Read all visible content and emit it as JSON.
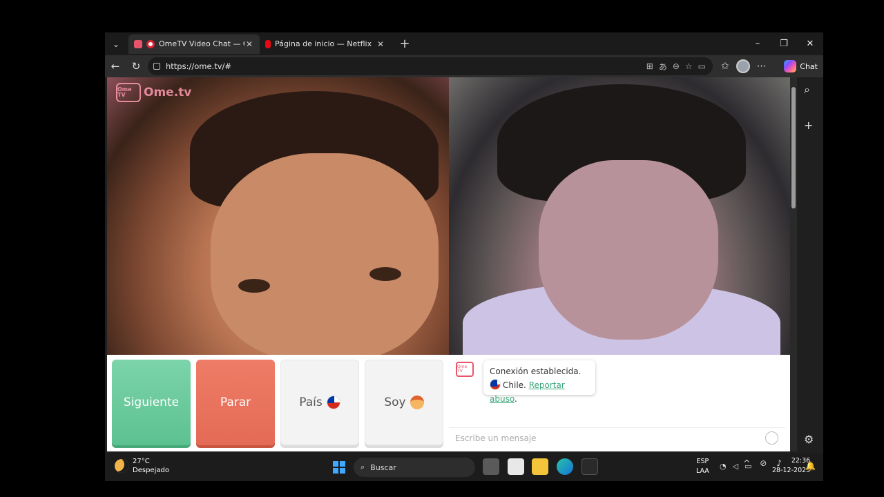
{
  "browser": {
    "tabs": [
      {
        "title": "OmeTV Video Chat — Omegle",
        "active": true,
        "favicon_color": "#e9546b"
      },
      {
        "title": "Página de inicio — Netflix",
        "active": false,
        "favicon_color": "#e50914"
      }
    ],
    "url": "https://ome.tv/#",
    "copilot_label": "Chat",
    "icons": {
      "tab_list": "chevron-down-icon",
      "new_tab": "plus-icon",
      "back": "back-arrow-icon",
      "refresh": "refresh-icon",
      "minimize": "minimize-icon",
      "restore": "restore-icon",
      "close": "close-icon"
    }
  },
  "site": {
    "brand_tv": "Ome TV",
    "brand_name": "Ome.tv",
    "buttons": {
      "next": "Siguiente",
      "stop": "Parar",
      "country": "País",
      "me": "Soy"
    },
    "chat": {
      "mini_logo": "Ome TV",
      "status": "Conexión establecida.",
      "country": "Chile.",
      "report": "Reportar abuso",
      "report_suffix": ".",
      "input_placeholder": "Escribe un mensaje"
    },
    "colors": {
      "next": "#6cc99c",
      "stop": "#e8735d",
      "link": "#3aa57a"
    }
  },
  "taskbar": {
    "temperature": "27°C",
    "condition": "Despejado",
    "search_label": "Buscar",
    "lang_top": "ESP",
    "lang_bottom": "LAA",
    "time": "22:36",
    "date": "28-12-2025"
  }
}
